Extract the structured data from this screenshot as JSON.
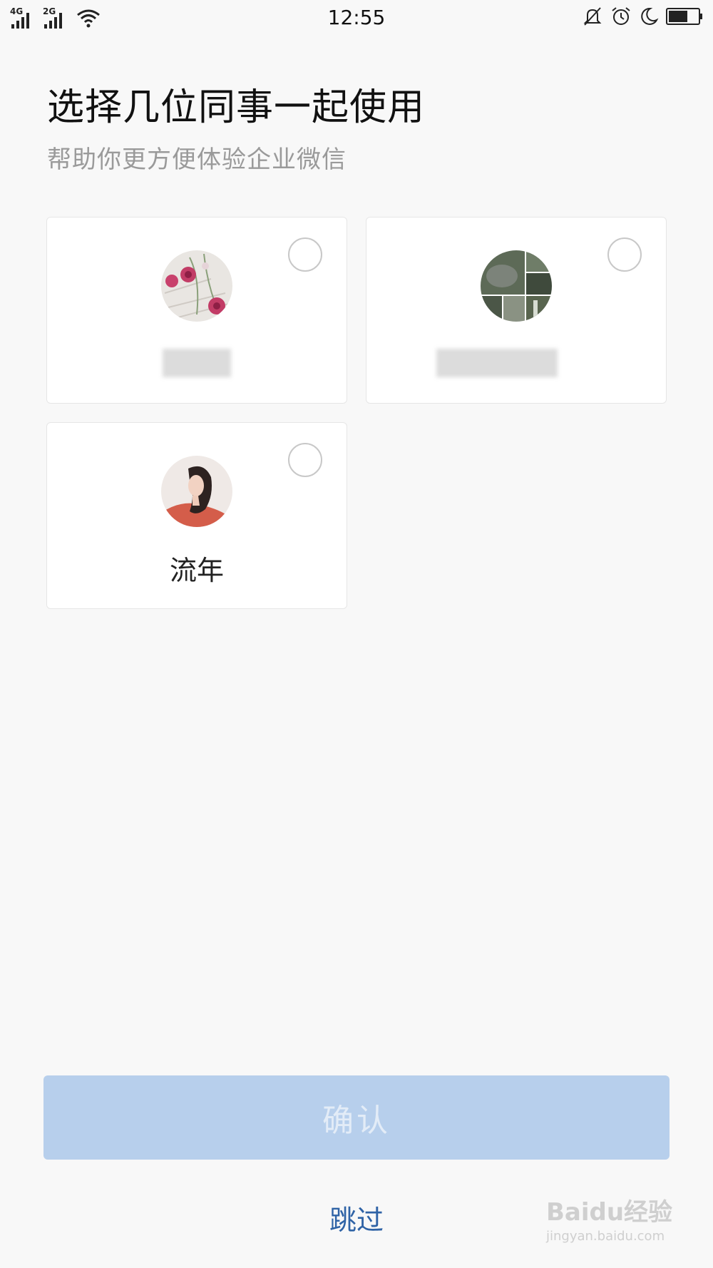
{
  "status_bar": {
    "network_1": "4G",
    "network_2": "2G",
    "time": "12:55",
    "icons": [
      "signal-icon",
      "wifi-icon",
      "silent-bell-icon",
      "alarm-icon",
      "moon-icon",
      "battery-icon"
    ]
  },
  "header": {
    "title": "选择几位同事一起使用",
    "subtitle": "帮助你更方便体验企业微信"
  },
  "colleagues": [
    {
      "name": "",
      "name_redacted": true,
      "avatar": "flowers-avatar",
      "selected": false
    },
    {
      "name": "",
      "name_redacted": true,
      "avatar": "landscape-collage-avatar",
      "selected": false
    },
    {
      "name": "流年",
      "name_redacted": false,
      "avatar": "woman-portrait-avatar",
      "selected": false
    }
  ],
  "actions": {
    "confirm_label": "确认",
    "skip_label": "跳过"
  },
  "watermark": {
    "main": "Baidu经验",
    "url": "jingyan.baidu.com"
  },
  "colors": {
    "background": "#f8f8f8",
    "confirm_disabled": "#b7cfec",
    "link": "#2f63a6"
  }
}
